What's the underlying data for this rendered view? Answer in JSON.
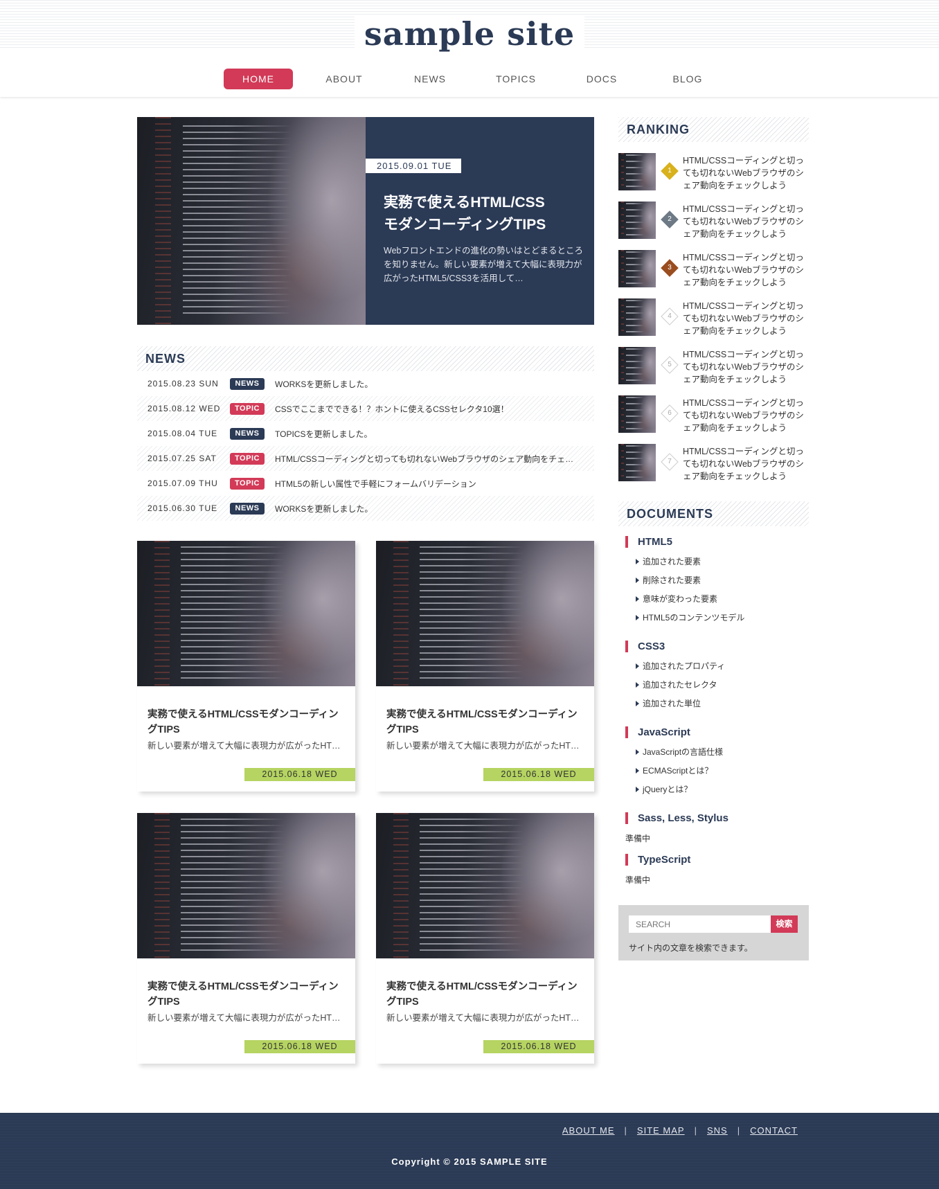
{
  "site": {
    "logo": "sample site"
  },
  "nav": [
    {
      "label": "HOME",
      "active": true
    },
    {
      "label": "ABOUT"
    },
    {
      "label": "NEWS"
    },
    {
      "label": "TOPICS"
    },
    {
      "label": "DOCS"
    },
    {
      "label": "BLOG"
    }
  ],
  "hero": {
    "date": "2015.09.01 TUE",
    "title": "実務で使えるHTML/CSS\nモダンコーディングTIPS",
    "text": "Webフロントエンドの進化の勢いはとどまるところを知りません。新しい要素が増えて大幅に表現力が広がったHTML5/CSS3を活用して…"
  },
  "news": {
    "heading": "NEWS",
    "items": [
      {
        "date": "2015.08.23 SUN",
        "type": "NEWS",
        "title": "WORKSを更新しました。"
      },
      {
        "date": "2015.08.12 WED",
        "type": "TOPIC",
        "title": "CSSでここまでできる！？ホントに使えるCSSセレクタ10選！"
      },
      {
        "date": "2015.08.04 TUE",
        "type": "NEWS",
        "title": "TOPICSを更新しました。"
      },
      {
        "date": "2015.07.25 SAT",
        "type": "TOPIC",
        "title": "HTML/CSSコーディングと切っても切れないWebブラウザのシェア動向をチェ…"
      },
      {
        "date": "2015.07.09 THU",
        "type": "TOPIC",
        "title": "HTML5の新しい属性で手軽にフォームバリデーション"
      },
      {
        "date": "2015.06.30 TUE",
        "type": "NEWS",
        "title": "WORKSを更新しました。"
      }
    ]
  },
  "cards": [
    {
      "title": "実務で使えるHTML/CSSモダンコーディングTIPS",
      "text": "新しい要素が増えて大幅に表現力が広がったHTM…",
      "date": "2015.06.18 WED"
    },
    {
      "title": "実務で使えるHTML/CSSモダンコーディングTIPS",
      "text": "新しい要素が増えて大幅に表現力が広がったHTM…",
      "date": "2015.06.18 WED"
    },
    {
      "title": "実務で使えるHTML/CSSモダンコーディングTIPS",
      "text": "新しい要素が増えて大幅に表現力が広がったHTM…",
      "date": "2015.06.18 WED"
    },
    {
      "title": "実務で使えるHTML/CSSモダンコーディングTIPS",
      "text": "新しい要素が増えて大幅に表現力が広がったHTM…",
      "date": "2015.06.18 WED"
    }
  ],
  "ranking": {
    "heading": "RANKING",
    "items": [
      {
        "rank": "1",
        "text": "HTML/CSSコーディングと切っても切れないWebブラウザのシェア動向をチェックしよう"
      },
      {
        "rank": "2",
        "text": "HTML/CSSコーディングと切っても切れないWebブラウザのシェア動向をチェックしよう"
      },
      {
        "rank": "3",
        "text": "HTML/CSSコーディングと切っても切れないWebブラウザのシェア動向をチェックしよう"
      },
      {
        "rank": "4",
        "text": "HTML/CSSコーディングと切っても切れないWebブラウザのシェア動向をチェックしよう"
      },
      {
        "rank": "5",
        "text": "HTML/CSSコーディングと切っても切れないWebブラウザのシェア動向をチェックしよう"
      },
      {
        "rank": "6",
        "text": "HTML/CSSコーディングと切っても切れないWebブラウザのシェア動向をチェックしよう"
      },
      {
        "rank": "7",
        "text": "HTML/CSSコーディングと切っても切れないWebブラウザのシェア動向をチェックしよう"
      }
    ]
  },
  "documents": {
    "heading": "DOCUMENTS",
    "groups": [
      {
        "title": "HTML5",
        "links": [
          "追加された要素",
          "削除された要素",
          "意味が変わった要素",
          "HTML5のコンテンツモデル"
        ]
      },
      {
        "title": "CSS3",
        "links": [
          "追加されたプロパティ",
          "追加されたセレクタ",
          "追加された単位"
        ]
      },
      {
        "title": "JavaScript",
        "links": [
          "JavaScriptの言語仕様",
          "ECMAScriptとは？",
          "jQueryとは？"
        ]
      },
      {
        "title": "Sass, Less, Stylus",
        "note": "準備中"
      },
      {
        "title": "TypeScript",
        "note": "準備中"
      }
    ]
  },
  "search": {
    "placeholder": "SEARCH",
    "button": "検索",
    "note": "サイト内の文章を検索できます。"
  },
  "footer": {
    "links": [
      "ABOUT ME",
      "SITE MAP",
      "SNS",
      "CONTACT"
    ],
    "separator": "|",
    "copyright": "Copyright © 2015 SAMPLE SITE"
  },
  "colors": {
    "navy": "#2b3a55",
    "accent": "#d23a57",
    "date_bar": "#b5d461",
    "rank_gold": "#d8b11c",
    "rank_silver": "#6d7a86",
    "rank_bronze": "#9a4e20"
  },
  "icons": {
    "rank_badge": "diamond-rank-icon",
    "doc_link": "triangle-right-icon"
  }
}
